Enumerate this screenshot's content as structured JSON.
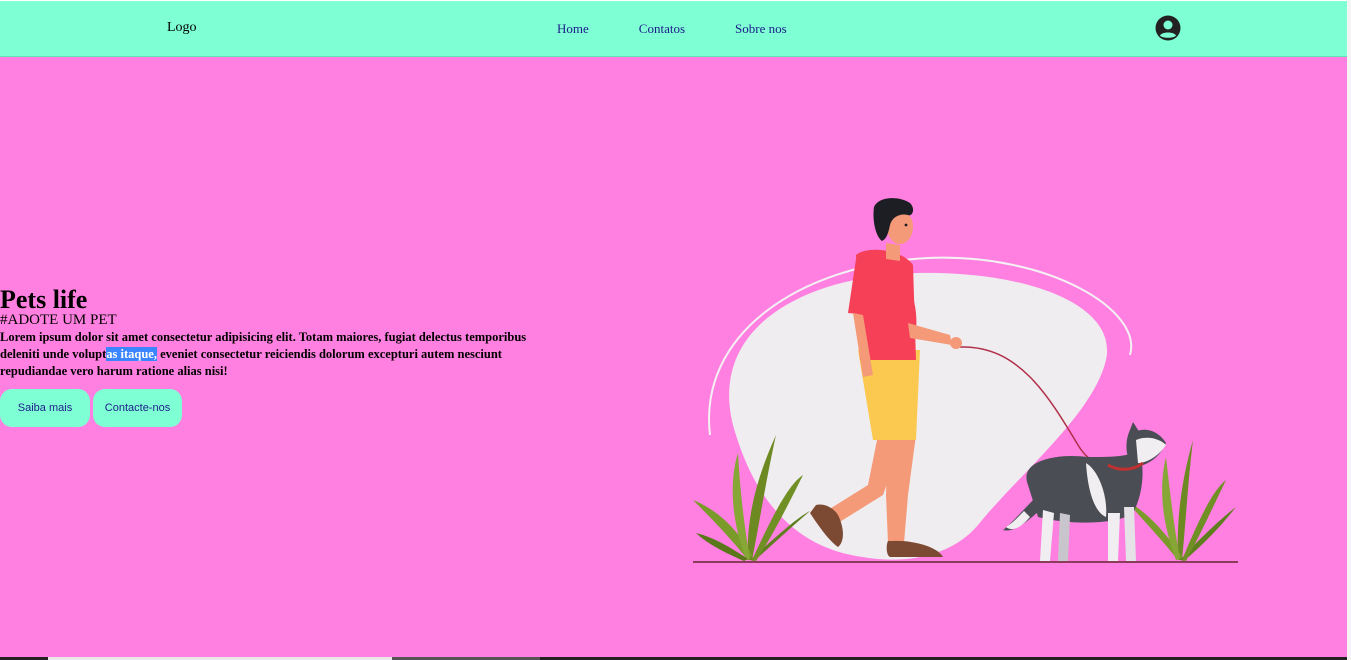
{
  "header": {
    "logo": "Logo",
    "nav": [
      "Home",
      "Contatos",
      "Sobre nos"
    ],
    "profile_icon": "account-circle-icon"
  },
  "hero": {
    "title": "Pets life",
    "subtitle": "#ADOTE UM PET",
    "text_before": "Lorem ipsum dolor sit amet consectetur adipisicing elit. Totam maiores, fugiat delectus temporibus deleniti unde volupt",
    "text_selected": "as itaque,",
    "text_after": " eveniet consectetur reiciendis dolorum excepturi autem nesciunt repudiandae vero harum ratione alias nisi!",
    "buttons": [
      "Saiba mais",
      "Contacte-nos"
    ]
  },
  "illustration": "man-walking-dog-illustration",
  "colors": {
    "background": "#ff80e0",
    "accent": "#7fffd4",
    "nav_text": "#1c1c8a",
    "selection": "#3b86ff"
  }
}
